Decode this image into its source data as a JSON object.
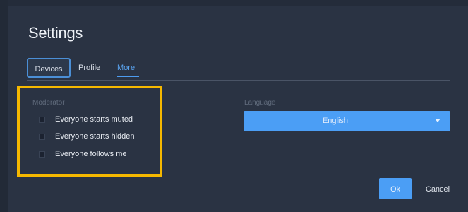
{
  "dialog": {
    "title": "Settings"
  },
  "tabs": [
    {
      "label": "Devices",
      "state": "focused"
    },
    {
      "label": "Profile",
      "state": "normal"
    },
    {
      "label": "More",
      "state": "selected"
    }
  ],
  "moderator": {
    "label": "Moderator",
    "options": [
      {
        "label": "Everyone starts muted",
        "checked": false
      },
      {
        "label": "Everyone starts hidden",
        "checked": false
      },
      {
        "label": "Everyone follows me",
        "checked": false
      }
    ]
  },
  "language": {
    "label": "Language",
    "selected": "English",
    "icon": "chevron-down-icon"
  },
  "footer": {
    "ok_label": "Ok",
    "cancel_label": "Cancel"
  },
  "colors": {
    "background": "#2a3343",
    "accent": "#4b9ef5",
    "highlight": "#f5b800"
  }
}
